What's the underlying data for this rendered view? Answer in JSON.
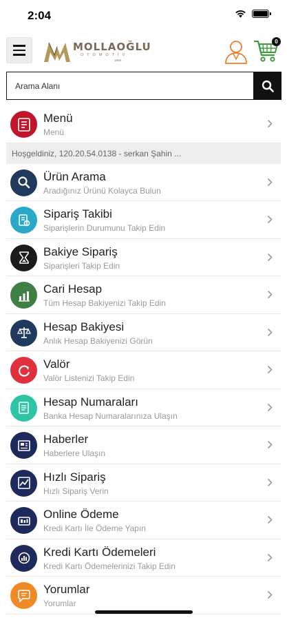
{
  "status_bar": {
    "time": "2:04"
  },
  "header": {
    "logo_name": "MOLLAOĞLU",
    "logo_sub": "OTOMOTİV",
    "logo_year": "1958",
    "cart_count": "0"
  },
  "search": {
    "placeholder": "Arama Alanı"
  },
  "menu": {
    "title": "Menü",
    "subtitle": "Menü"
  },
  "welcome": {
    "text": "Hoşgeldiniz, 120.20.54.0138 - serkan Şahin ..."
  },
  "items": [
    {
      "title": "Ürün Arama",
      "subtitle": "Aradığınız Ürünü Kolayca Bulun",
      "color": "#1f3a5c",
      "icon": "magnifier-icon"
    },
    {
      "title": "Sipariş Takibi",
      "subtitle": "Siparişlerin Durumunu Takip Edin",
      "color": "#2aa8c9",
      "icon": "order-tracking-icon"
    },
    {
      "title": "Bakiye Sipariş",
      "subtitle": "Siparişleri Takip Edin",
      "color": "#1b1b1b",
      "icon": "hourglass-icon"
    },
    {
      "title": "Cari Hesap",
      "subtitle": "Tüm Hesap Bakiyenizi Takip Edin",
      "color": "#3f7f44",
      "icon": "bar-chart-icon"
    },
    {
      "title": "Hesap Bakiyesi",
      "subtitle": "Anlık Hesap Bakiyenizi Görün",
      "color": "#1f3a5c",
      "icon": "scales-icon"
    },
    {
      "title": "Valör",
      "subtitle": "Valör Listenizi Takip Edin",
      "color": "#e0303e",
      "icon": "refresh-icon"
    },
    {
      "title": "Hesap Numaraları",
      "subtitle": "Banka Hesap Numaralarınıza Ulaşın",
      "color": "#2ec4a6",
      "icon": "document-icon"
    },
    {
      "title": "Haberler",
      "subtitle": "Haberlere Ulaşın",
      "color": "#1f2a5c",
      "icon": "newspaper-icon"
    },
    {
      "title": "Hızlı Sipariş",
      "subtitle": "Hızlı Sipariş Verin",
      "color": "#1f2a5c",
      "icon": "chart-line-icon"
    },
    {
      "title": "Online Ödeme",
      "subtitle": "Kredi Kartı İle Ödeme Yapın",
      "color": "#1f2a5c",
      "icon": "payment-icon"
    },
    {
      "title": "Kredi Kartı Ödemeleri",
      "subtitle": "Kredi Kartı Ödemelerinizi Takip Edin",
      "color": "#1f2a5c",
      "icon": "stats-circle-icon"
    },
    {
      "title": "Yorumlar",
      "subtitle": "Yorumlar",
      "color": "#f08a24",
      "icon": "comment-icon"
    }
  ]
}
